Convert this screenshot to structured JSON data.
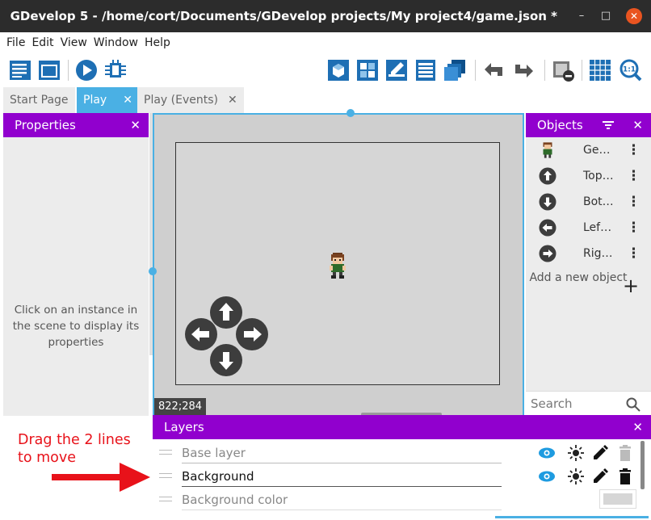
{
  "window": {
    "title": "GDevelop 5 - /home/cort/Documents/GDevelop projects/My project4/game.json *",
    "min": "–",
    "max": "□",
    "close": "✕"
  },
  "menu": [
    "File",
    "Edit",
    "View",
    "Window",
    "Help"
  ],
  "toolbar_icons": [
    "project-manager-icon",
    "scene-icon",
    "preview-play-icon",
    "debugger-icon",
    "object-editor-icon",
    "object-groups-icon",
    "properties-edit-icon",
    "instances-list-icon",
    "layers-icon",
    "undo-icon",
    "redo-icon",
    "delete-instance-icon",
    "grid-icon",
    "zoom-reset-icon"
  ],
  "tabs": [
    {
      "label": "Start Page",
      "closable": false
    },
    {
      "label": "Play",
      "closable": true,
      "active": true
    },
    {
      "label": "Play (Events)",
      "closable": true
    }
  ],
  "tab_close": "✕",
  "properties": {
    "title": "Properties",
    "close": "✕",
    "empty_message": "Click on an instance in the scene to display its properties"
  },
  "scene": {
    "coordinates": "822;284"
  },
  "objects": {
    "title": "Objects",
    "close": "✕",
    "items": [
      {
        "name": "Ge…",
        "icon": "character-sprite-icon"
      },
      {
        "name": "Top…",
        "icon": "arrow-up-icon"
      },
      {
        "name": "Bot…",
        "icon": "arrow-down-icon"
      },
      {
        "name": "Lef…",
        "icon": "arrow-left-icon"
      },
      {
        "name": "Rig…",
        "icon": "arrow-right-icon"
      }
    ],
    "more": "⋮",
    "add_label": "Add a new object",
    "add_plus": "+",
    "search_placeholder": "Search"
  },
  "layers": {
    "title": "Layers",
    "close": "✕",
    "items": [
      {
        "name": "Base layer",
        "active": false
      },
      {
        "name": "Background",
        "active": true
      }
    ],
    "background_color_label": "Background color"
  },
  "annotation": {
    "text": "Drag the 2 lines to move"
  },
  "colors": {
    "accent_purple": "#9100ce",
    "tab_blue": "#4ab0e4",
    "toolbar_blue": "#1e6fb4",
    "arrow_red": "#e8121a"
  }
}
